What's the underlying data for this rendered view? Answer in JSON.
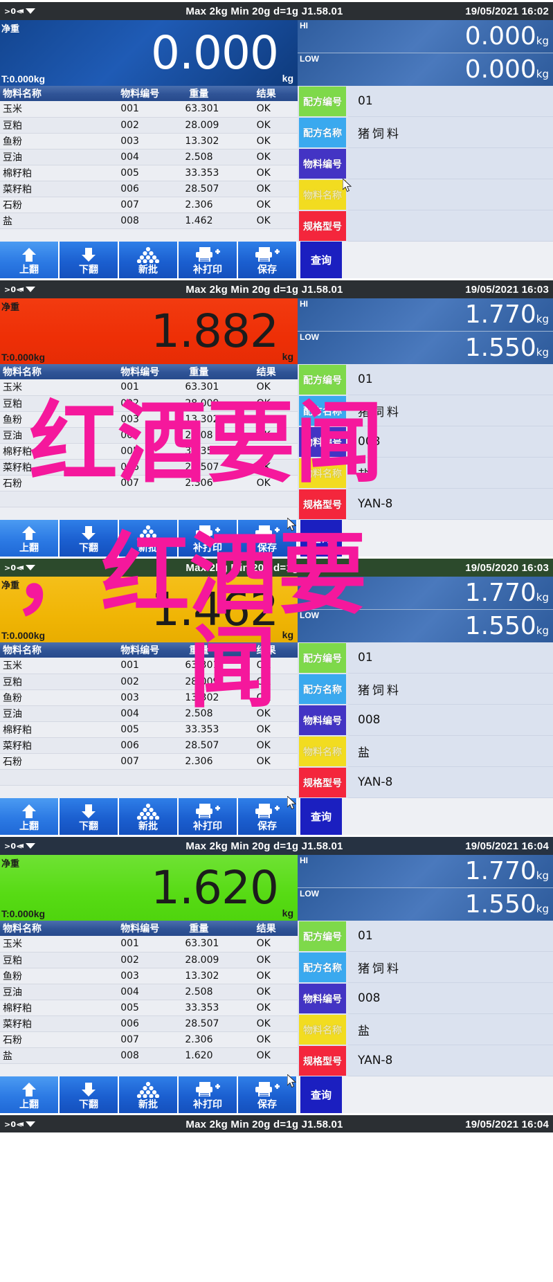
{
  "common": {
    "spec_text": "Max 2kg  Min 20g  d=1g    J1.58.01",
    "net_label": "净重",
    "unit": "kg",
    "hi_tag": "HI",
    "low_tag": "LOW",
    "table_headers": [
      "物料名称",
      "物料编号",
      "重量",
      "结果"
    ],
    "field_labels": {
      "recipe_code": "配方编号",
      "recipe_name": "配方名称",
      "material_code": "物料编号",
      "material_name": "物料名称",
      "spec_model": "规格型号"
    },
    "buttons": [
      {
        "label": "上翻",
        "icon": "arrow-up-icon"
      },
      {
        "label": "下翻",
        "icon": "arrow-down-icon"
      },
      {
        "label": "新批",
        "icon": "batch-stack-icon"
      },
      {
        "label": "补打印",
        "icon": "printer-plus-icon"
      },
      {
        "label": "保存",
        "icon": "printer-save-icon"
      }
    ],
    "query_button": "查询",
    "colors": {
      "tag_green": "#7ed94a",
      "tag_blue": "#3aa9ef",
      "tag_purple": "#4334c4",
      "tag_yellow": "#f2dc20",
      "tag_red": "#f4263c",
      "display_blue": "#13458f",
      "display_red": "#ee2f06",
      "display_yellow": "#f0b505",
      "display_green": "#57db14",
      "watermark": "#f5189c"
    }
  },
  "watermark": {
    "line1": "红酒要闻",
    "line2": "，红酒要",
    "line3": "闻"
  },
  "panels": [
    {
      "id": "panel-1",
      "statusbar_theme": "dark",
      "datetime": "19/05/2021  16:02",
      "display_theme": "blue",
      "weight": "0.000",
      "tare": "T:0.000kg",
      "hi": "0.000",
      "low": "0.000",
      "rows": [
        {
          "name": "玉米",
          "code": "001",
          "weight": "63.301",
          "result": "OK"
        },
        {
          "name": "豆粕",
          "code": "002",
          "weight": "28.009",
          "result": "OK"
        },
        {
          "name": "鱼粉",
          "code": "003",
          "weight": "13.302",
          "result": "OK"
        },
        {
          "name": "豆油",
          "code": "004",
          "weight": "2.508",
          "result": "OK"
        },
        {
          "name": "棉籽粕",
          "code": "005",
          "weight": "33.353",
          "result": "OK"
        },
        {
          "name": "菜籽粕",
          "code": "006",
          "weight": "28.507",
          "result": "OK"
        },
        {
          "name": "石粉",
          "code": "007",
          "weight": "2.306",
          "result": "OK"
        },
        {
          "name": "盐",
          "code": "008",
          "weight": "1.462",
          "result": "OK"
        }
      ],
      "fields": {
        "recipe_code": "01",
        "recipe_name": "猪饲料",
        "material_code": "",
        "material_name": "",
        "spec_model": ""
      },
      "cursor_on": "material-name-tag"
    },
    {
      "id": "panel-2",
      "statusbar_theme": "dark",
      "datetime": "19/05/2021  16:03",
      "display_theme": "red",
      "weight": "1.882",
      "tare": "T:0.000kg",
      "hi": "1.770",
      "low": "1.550",
      "rows": [
        {
          "name": "玉米",
          "code": "001",
          "weight": "63.301",
          "result": "OK"
        },
        {
          "name": "豆粕",
          "code": "002",
          "weight": "28.009",
          "result": "OK"
        },
        {
          "name": "鱼粉",
          "code": "003",
          "weight": "13.302",
          "result": "OK"
        },
        {
          "name": "豆油",
          "code": "004",
          "weight": "2.508",
          "result": "OK"
        },
        {
          "name": "棉籽粕",
          "code": "005",
          "weight": "33.353",
          "result": "OK"
        },
        {
          "name": "菜籽粕",
          "code": "006",
          "weight": "28.507",
          "result": "OK"
        },
        {
          "name": "石粉",
          "code": "007",
          "weight": "2.306",
          "result": "OK"
        },
        {
          "name": "",
          "code": "",
          "weight": "",
          "result": ""
        }
      ],
      "fields": {
        "recipe_code": "01",
        "recipe_name": "猪饲料",
        "material_code": "008",
        "material_name": "盐",
        "spec_model": "YAN-8"
      },
      "cursor_on": "save-button"
    },
    {
      "id": "panel-3",
      "statusbar_theme": "green",
      "datetime": "19/05/2020  16:03",
      "display_theme": "yellow",
      "weight": "1.462",
      "tare": "T:0.000kg",
      "hi": "1.770",
      "low": "1.550",
      "rows": [
        {
          "name": "玉米",
          "code": "001",
          "weight": "63.301",
          "result": "OK"
        },
        {
          "name": "豆粕",
          "code": "002",
          "weight": "28.009",
          "result": "OK"
        },
        {
          "name": "鱼粉",
          "code": "003",
          "weight": "13.302",
          "result": "OK"
        },
        {
          "name": "豆油",
          "code": "004",
          "weight": "2.508",
          "result": "OK"
        },
        {
          "name": "棉籽粕",
          "code": "005",
          "weight": "33.353",
          "result": "OK"
        },
        {
          "name": "菜籽粕",
          "code": "006",
          "weight": "28.507",
          "result": "OK"
        },
        {
          "name": "石粉",
          "code": "007",
          "weight": "2.306",
          "result": "OK"
        },
        {
          "name": "",
          "code": "",
          "weight": "",
          "result": ""
        }
      ],
      "fields": {
        "recipe_code": "01",
        "recipe_name": "猪饲料",
        "material_code": "008",
        "material_name": "盐",
        "spec_model": "YAN-8"
      },
      "cursor_on": "save-button"
    },
    {
      "id": "panel-4",
      "statusbar_theme": "navy",
      "datetime": "19/05/2021  16:04",
      "display_theme": "green",
      "weight": "1.620",
      "tare": "T:0.000kg",
      "hi": "1.770",
      "low": "1.550",
      "rows": [
        {
          "name": "玉米",
          "code": "001",
          "weight": "63.301",
          "result": "OK"
        },
        {
          "name": "豆粕",
          "code": "002",
          "weight": "28.009",
          "result": "OK"
        },
        {
          "name": "鱼粉",
          "code": "003",
          "weight": "13.302",
          "result": "OK"
        },
        {
          "name": "豆油",
          "code": "004",
          "weight": "2.508",
          "result": "OK"
        },
        {
          "name": "棉籽粕",
          "code": "005",
          "weight": "33.353",
          "result": "OK"
        },
        {
          "name": "菜籽粕",
          "code": "006",
          "weight": "28.507",
          "result": "OK"
        },
        {
          "name": "石粉",
          "code": "007",
          "weight": "2.306",
          "result": "OK"
        },
        {
          "name": "盐",
          "code": "008",
          "weight": "1.620",
          "result": "OK"
        }
      ],
      "fields": {
        "recipe_code": "01",
        "recipe_name": "猪饲料",
        "material_code": "008",
        "material_name": "盐",
        "spec_model": "YAN-8"
      },
      "cursor_on": "save-button"
    },
    {
      "id": "panel-5",
      "statusbar_theme": "dark",
      "datetime": "19/05/2021  16:04",
      "display_theme": "blue",
      "weight": "",
      "tare": "",
      "hi": "",
      "low": "",
      "rows": [],
      "fields": {
        "recipe_code": "",
        "recipe_name": "",
        "material_code": "",
        "material_name": "",
        "spec_model": ""
      },
      "cursor_on": ""
    }
  ]
}
